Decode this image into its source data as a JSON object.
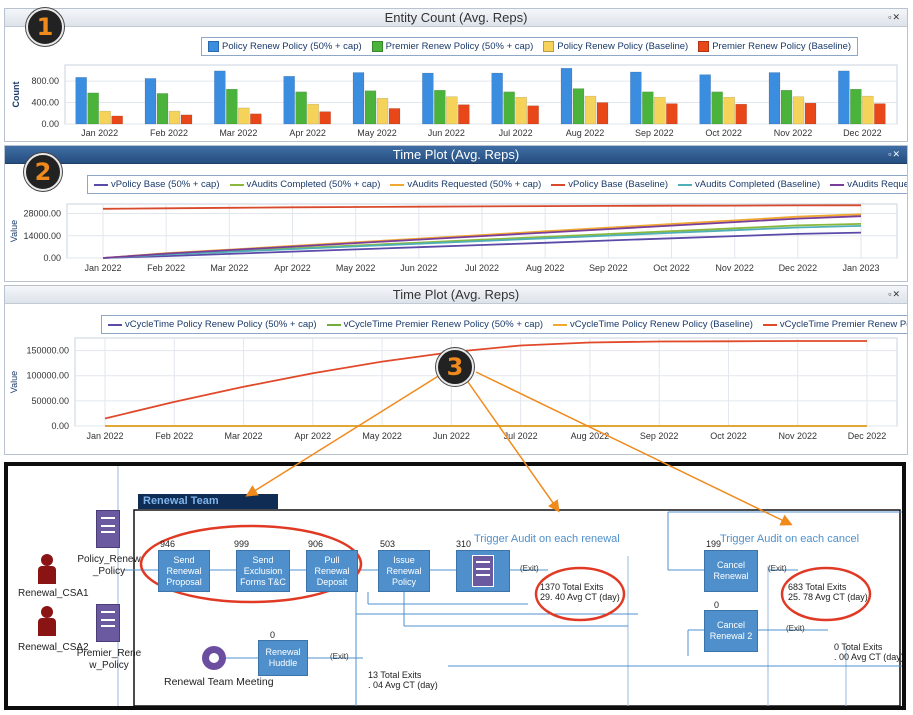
{
  "badges": {
    "b1": "1",
    "b2": "2",
    "b3": "3"
  },
  "panel1": {
    "title": "Entity Count (Avg. Reps)",
    "ylabel": "Count",
    "legend": [
      "Policy Renew Policy (50% + cap)",
      "Premier Renew Policy (50% + cap)",
      "Policy Renew Policy (Baseline)",
      "Premier Renew Policy (Baseline)"
    ]
  },
  "panel2": {
    "title": "Time Plot (Avg. Reps)",
    "ylabel": "Value",
    "legend": [
      "vPolicy Base (50% + cap)",
      "vAudits Completed (50% + cap)",
      "vAudits Requested (50% + cap)",
      "vPolicy Base (Baseline)",
      "vAudits Completed (Baseline)",
      "vAudits Requested (Baseline)"
    ]
  },
  "panel3": {
    "title": "Time Plot (Avg. Reps)",
    "ylabel": "Value",
    "legend": [
      "vCycleTime Policy Renew Policy (50% + cap)",
      "vCycleTime Premier Renew Policy (50% + cap)",
      "vCycleTime Policy Renew Policy (Baseline)",
      "vCycleTime Premier Renew Policy (Baseline)"
    ]
  },
  "chart_data": [
    {
      "type": "bar",
      "title": "Entity Count (Avg. Reps)",
      "ylabel": "Count",
      "categories": [
        "Jan 2022",
        "Feb 2022",
        "Mar 2022",
        "Apr 2022",
        "May 2022",
        "Jun 2022",
        "Jul 2022",
        "Aug 2022",
        "Sep 2022",
        "Oct 2022",
        "Nov 2022",
        "Dec 2022"
      ],
      "yticks": [
        "0.00",
        "400.00",
        "800.00"
      ],
      "ylim": [
        0,
        1100
      ],
      "legend_position": "top-center",
      "series": [
        {
          "name": "Policy Renew Policy (50% + cap)",
          "color": "#3b8de0",
          "values": [
            870,
            850,
            990,
            890,
            960,
            950,
            950,
            1040,
            970,
            920,
            960,
            990
          ]
        },
        {
          "name": "Premier Renew Policy (50% + cap)",
          "color": "#4bb33c",
          "values": [
            580,
            570,
            650,
            600,
            620,
            630,
            600,
            660,
            600,
            600,
            630,
            650
          ]
        },
        {
          "name": "Policy Renew Policy (Baseline)",
          "color": "#f5d25a",
          "values": [
            240,
            240,
            300,
            370,
            480,
            510,
            500,
            520,
            500,
            500,
            510,
            520
          ]
        },
        {
          "name": "Premier Renew Policy (Baseline)",
          "color": "#e8471a",
          "values": [
            150,
            170,
            190,
            230,
            290,
            360,
            340,
            400,
            380,
            370,
            390,
            380
          ]
        }
      ]
    },
    {
      "type": "line",
      "title": "Time Plot (Avg. Reps)",
      "ylabel": "Value",
      "x": [
        "Jan 2022",
        "Feb 2022",
        "Mar 2022",
        "Apr 2022",
        "May 2022",
        "Jun 2022",
        "Jul 2022",
        "Aug 2022",
        "Sep 2022",
        "Oct 2022",
        "Nov 2022",
        "Dec 2022",
        "Jan 2023"
      ],
      "yticks": [
        "0.00",
        "14000.00",
        "28000.00"
      ],
      "ylim": [
        0,
        34000
      ],
      "legend_position": "top-center",
      "series": [
        {
          "name": "vPolicy Base (50% + cap)",
          "color": "#5b4aa8",
          "values": [
            0,
            1200,
            2600,
            4000,
            5400,
            6800,
            8200,
            9600,
            11000,
            12400,
            13800,
            15200,
            16000
          ]
        },
        {
          "name": "vAudits Completed (50% + cap)",
          "color": "#8bb83c",
          "values": [
            0,
            2500,
            4300,
            6100,
            7900,
            9700,
            11500,
            13300,
            15100,
            16900,
            18700,
            20500,
            21500
          ]
        },
        {
          "name": "vAudits Requested (50% + cap)",
          "color": "#f0a830",
          "values": [
            0,
            3000,
            5300,
            7600,
            9900,
            12200,
            14500,
            16800,
            19100,
            21400,
            23700,
            26000,
            27500
          ]
        },
        {
          "name": "vPolicy Base (Baseline)",
          "color": "#d84a2c",
          "values": [
            31000,
            31300,
            31600,
            31900,
            32100,
            32300,
            32500,
            32700,
            32800,
            32900,
            33000,
            33100,
            33200
          ]
        },
        {
          "name": "vAudits Completed (Baseline)",
          "color": "#4fb0b8",
          "values": [
            0,
            2200,
            3900,
            5600,
            7300,
            9000,
            10700,
            12400,
            14100,
            15800,
            17500,
            19200,
            20200
          ]
        },
        {
          "name": "vAudits Requested (Baseline)",
          "color": "#7a3e9a",
          "values": [
            0,
            2800,
            5000,
            7200,
            9400,
            11600,
            13800,
            16000,
            18200,
            20400,
            22600,
            24800,
            26300
          ]
        }
      ]
    },
    {
      "type": "line",
      "title": "Time Plot (Avg. Reps)",
      "ylabel": "Value",
      "x": [
        "Jan 2022",
        "Feb 2022",
        "Mar 2022",
        "Apr 2022",
        "May 2022",
        "Jun 2022",
        "Jul 2022",
        "Aug 2022",
        "Sep 2022",
        "Oct 2022",
        "Nov 2022",
        "Dec 2022"
      ],
      "yticks": [
        "0.00",
        "50000.00",
        "100000.00",
        "150000.00"
      ],
      "ylim": [
        0,
        175000
      ],
      "legend_position": "top-center",
      "series": [
        {
          "name": "vCycleTime Policy Renew Policy (50% + cap)",
          "color": "#5b4aa8",
          "values": [
            0,
            0,
            0,
            0,
            0,
            0,
            0,
            0,
            0,
            0,
            0,
            0
          ]
        },
        {
          "name": "vCycleTime Premier Renew Policy (50% + cap)",
          "color": "#6fae3a",
          "values": [
            0,
            0,
            0,
            0,
            0,
            0,
            0,
            0,
            0,
            0,
            0,
            0
          ]
        },
        {
          "name": "vCycleTime Policy Renew Policy (Baseline)",
          "color": "#f0a830",
          "values": [
            0,
            0,
            0,
            0,
            0,
            0,
            0,
            0,
            0,
            0,
            0,
            0
          ]
        },
        {
          "name": "vCycleTime Premier Renew Policy (Baseline)",
          "color": "#e04a2a",
          "values": [
            15000,
            48000,
            78000,
            105000,
            128000,
            147000,
            160000,
            166000,
            168000,
            168500,
            169000,
            169000
          ]
        }
      ]
    }
  ],
  "process": {
    "team_label": "Renewal Team",
    "resources": [
      {
        "name": "Renewal_CSA1",
        "icon": "person-icon"
      },
      {
        "name": "Renewal_CSA2",
        "icon": "person-icon"
      }
    ],
    "docs": [
      {
        "name": "Policy_Renew_Policy",
        "line1": "Policy_Renew",
        "line2": "_Policy",
        "icon": "document-icon"
      },
      {
        "name": "Premier_Renew_Policy",
        "line1": "Premier_Rene",
        "line2": "w_Policy",
        "icon": "document-icon"
      }
    ],
    "meeting_label": "Renewal Team Meeting",
    "steps": [
      {
        "count": "946",
        "label": "Send Renewal Proposal"
      },
      {
        "count": "999",
        "label": "Send Exclusion Forms T&C"
      },
      {
        "count": "906",
        "label": "Pull Renewal Deposit"
      },
      {
        "count": "503",
        "label": "Issue Renewal Policy"
      },
      {
        "count": "310",
        "label": ""
      },
      {
        "count": "199",
        "label": "Cancel Renewal"
      },
      {
        "count": "0",
        "label": "Cancel Renewal 2"
      },
      {
        "count": "0",
        "label": "Renewal Huddle"
      }
    ],
    "trigger_renewal": "Trigger Audit on each renewal",
    "trigger_cancel": "Trigger Audit on each cancel",
    "exit_label": "(Exit)",
    "stats": [
      {
        "exits": "1370  Total Exits",
        "ct": "29. 40  Avg CT (day)"
      },
      {
        "exits": "683  Total Exits",
        "ct": "25. 78  Avg CT (day)"
      },
      {
        "exits": "0  Total Exits",
        "ct": ". 00  Avg CT (day)"
      },
      {
        "exits": "13  Total Exits",
        "ct": ". 04  Avg CT (day)"
      }
    ],
    "colors": {
      "box": "#4f90cc",
      "highlight": "#e03a25",
      "arrow": "#f08a1c"
    }
  }
}
